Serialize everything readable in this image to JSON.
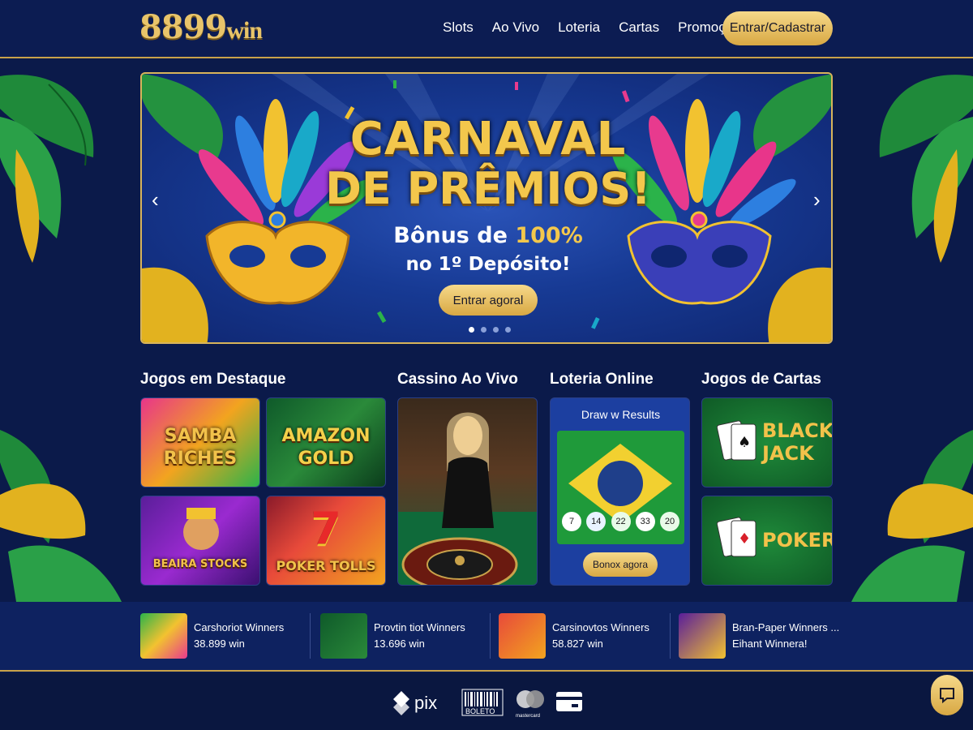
{
  "header": {
    "logo_main": "8899",
    "logo_suffix": "win",
    "nav": [
      "Slots",
      "Ao Vivo",
      "Loteria",
      "Cartas",
      "Promoções"
    ],
    "login_label": "Entrar/Cadastrar"
  },
  "banner": {
    "title_line1": "CARNAVAL",
    "title_line2": "DE PRÊMIOS!",
    "sub_line1_prefix": "Bônus de ",
    "sub_line1_highlight": "100%",
    "sub_line2": "no 1º Depósito!",
    "cta_label": "Entrar agoral",
    "slides_total": 4,
    "slide_active": 1
  },
  "sections": {
    "featured_title": "Jogos em Destaque",
    "live_title": "Cassino Ao Vivo",
    "lottery_title": "Loteria Online",
    "cards_title": "Jogos de Cartas"
  },
  "featured_games": [
    {
      "line1": "SAMBA",
      "line2": "RICHES"
    },
    {
      "line1": "AMAZON",
      "line2": "GOLD"
    },
    {
      "line1": "BEAIRA STOCKS",
      "line2": ""
    },
    {
      "line1": "POKER TOLLS",
      "line2": ""
    }
  ],
  "lottery": {
    "card_title": "Draw w Results",
    "balls": [
      "7",
      "14",
      "22",
      "33",
      "20"
    ],
    "button_label": "Bonox agora"
  },
  "card_games": [
    {
      "line1": "BLACK",
      "line2": "JACK"
    },
    {
      "line1": "POKER",
      "line2": ""
    }
  ],
  "winners": [
    {
      "name": "Carshoriot Winners",
      "amount": "38.899 win"
    },
    {
      "name": "Provtin tiot Winners",
      "amount": "13.696 win"
    },
    {
      "name": "Carsinovtos Winners",
      "amount": "58.827 win"
    },
    {
      "name": "Bran-Paper Winners ...",
      "amount": "Eihant Winnera!"
    }
  ],
  "payments": {
    "pix": "pix",
    "boleto": "BOLETO",
    "mastercard": "mastercard"
  },
  "colors": {
    "navy": "#0b1a4a",
    "gold": "#d8a843",
    "gold_light": "#f6d98a",
    "banner_blue": "#173a94",
    "green_card": "#0f6a2f"
  }
}
